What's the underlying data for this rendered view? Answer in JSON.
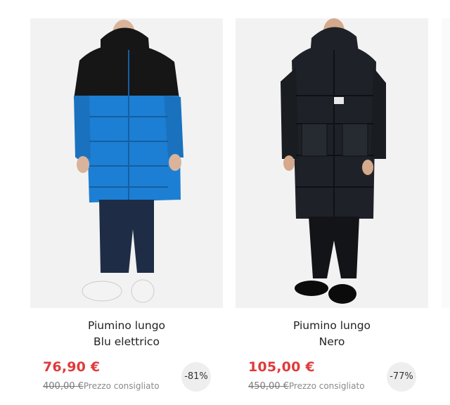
{
  "products": [
    {
      "name_line1": "Piumino lungo",
      "name_line2": "Blu elettrico",
      "price": "76,90 €",
      "old_price": "400,00 €",
      "rrp_label": "Prezzo consigliato",
      "discount": "-81%",
      "jacket_color": "#1d7fd3"
    },
    {
      "name_line1": "Piumino lungo",
      "name_line2": "Nero",
      "price": "105,00 €",
      "old_price": "450,00 €",
      "rrp_label": "Prezzo consigliato",
      "discount": "-77%",
      "jacket_color": "#1e2228"
    }
  ],
  "colors": {
    "sale_price": "#e03a3a",
    "badge_bg": "#eeeeee",
    "image_bg": "#f2f2f2"
  }
}
